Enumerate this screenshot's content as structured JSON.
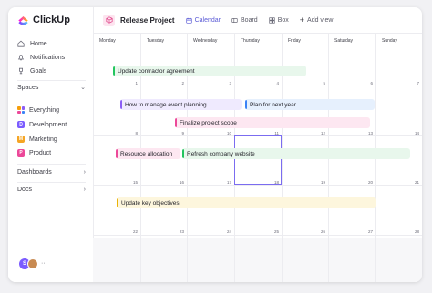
{
  "sidebar": {
    "brand": "ClickUp",
    "nav": [
      {
        "label": "Home",
        "icon": "home-icon"
      },
      {
        "label": "Notifications",
        "icon": "bell-icon"
      },
      {
        "label": "Goals",
        "icon": "trophy-icon"
      }
    ],
    "spaces_label": "Spaces",
    "spaces": [
      {
        "label": "Everything",
        "badge": "",
        "color": ""
      },
      {
        "label": "Development",
        "badge": "D",
        "color": "#7b5cff"
      },
      {
        "label": "Marketing",
        "badge": "M",
        "color": "#f5a524"
      },
      {
        "label": "Product",
        "badge": "P",
        "color": "#ec4899"
      }
    ],
    "dashboards_label": "Dashboards",
    "docs_label": "Docs",
    "avatar_initial": "S",
    "avatar_more": "··"
  },
  "header": {
    "project_title": "Release Project",
    "tabs": [
      {
        "label": "Calendar",
        "icon": "calendar-icon",
        "active": true
      },
      {
        "label": "Board",
        "icon": "board-icon",
        "active": false
      },
      {
        "label": "Box",
        "icon": "box-icon",
        "active": false
      }
    ],
    "add_view_label": "Add view"
  },
  "calendar": {
    "days": [
      "Monday",
      "Tuesday",
      "Wednesday",
      "Thursday",
      "Friday",
      "Saturday",
      "Sunday"
    ],
    "weeks": [
      [
        "1",
        "2",
        "3",
        "4",
        "5",
        "6",
        "7"
      ],
      [
        "8",
        "9",
        "10",
        "11",
        "12",
        "13",
        "14"
      ],
      [
        "15",
        "16",
        "17",
        "18",
        "19",
        "20",
        "21"
      ],
      [
        "22",
        "23",
        "24",
        "25",
        "26",
        "27",
        "28"
      ]
    ],
    "events": [
      {
        "label": "Update contractor agreement",
        "accent": "#22c55e",
        "bg": "#e8f7ec"
      },
      {
        "label": "How to manage event planning",
        "accent": "#8b5cf6",
        "bg": "#efeafe"
      },
      {
        "label": "Plan for next year",
        "accent": "#3b82f6",
        "bg": "#e6f0fd"
      },
      {
        "label": "Finalize project scope",
        "accent": "#ec4899",
        "bg": "#fde7f1"
      },
      {
        "label": "Resource allocation",
        "accent": "#ec4899",
        "bg": "#fde7f1"
      },
      {
        "label": "Refresh company website",
        "accent": "#22c55e",
        "bg": "#e8f7ec"
      },
      {
        "label": "Update key objectives",
        "accent": "#eab308",
        "bg": "#fdf6dd"
      }
    ]
  }
}
